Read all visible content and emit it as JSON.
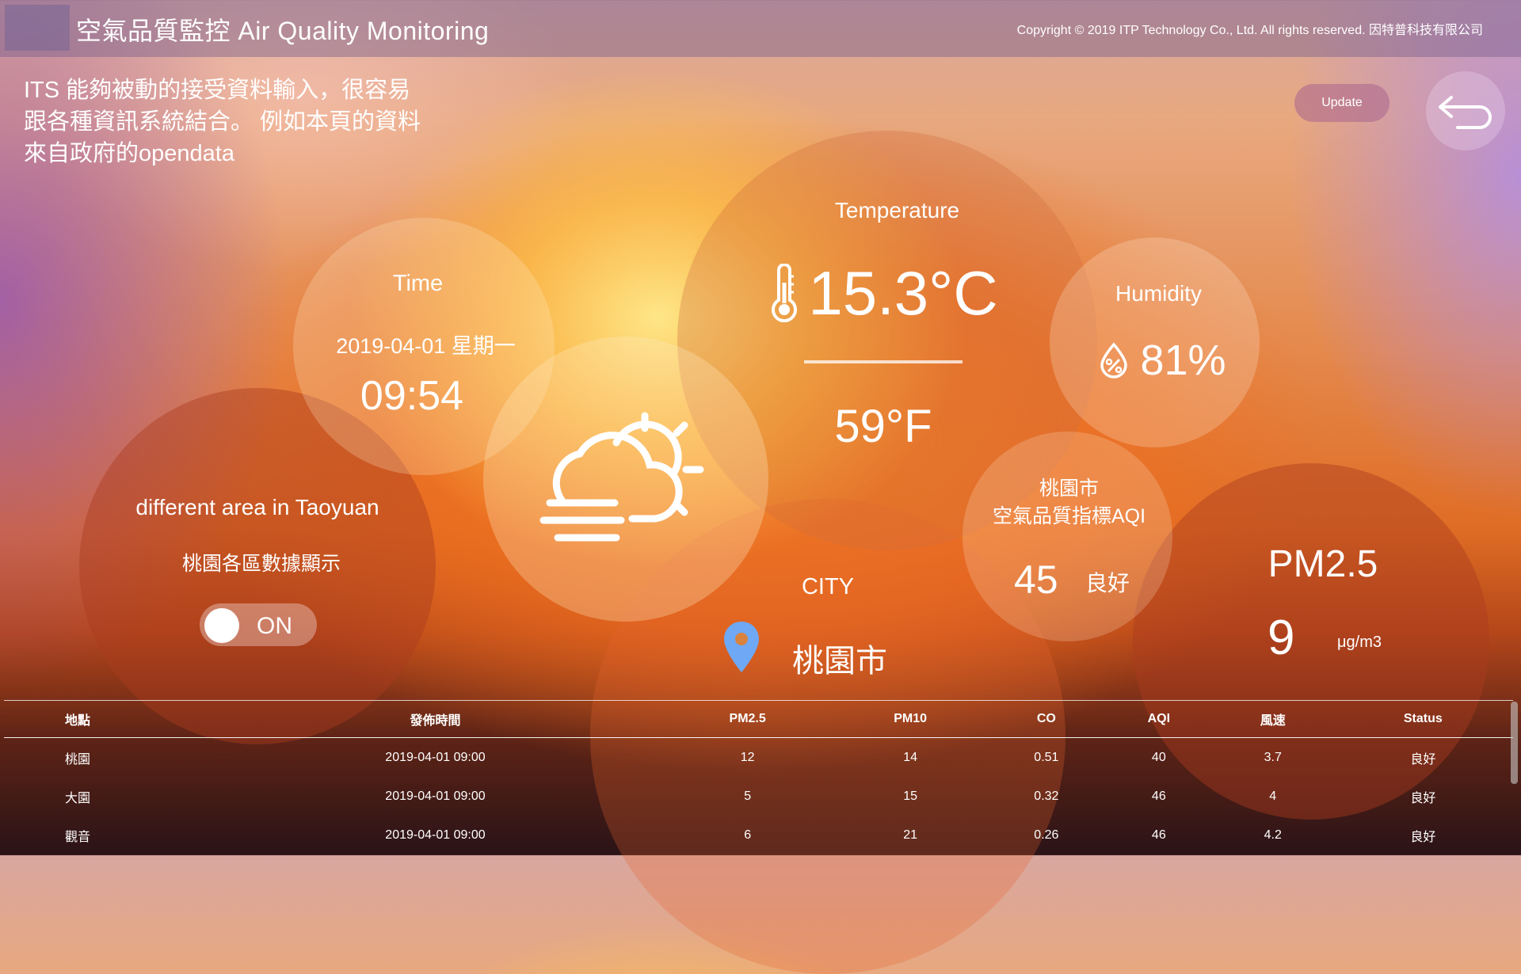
{
  "header": {
    "title": "空氣品質監控  Air Quality Monitoring",
    "copyright": "Copyright © 2019 ITP Technology Co., Ltd. All rights reserved. 因特普科技有限公司"
  },
  "intro": {
    "line1": "ITS 能夠被動的接受資料輸入，很容易",
    "line2": "跟各種資訊系統結合。 例如本頁的資料",
    "line3": "來自政府的opendata"
  },
  "controls": {
    "update_label": "Update"
  },
  "time": {
    "title": "Time",
    "date": "2019-04-01  星期一",
    "clock": "09:54"
  },
  "temperature": {
    "title": "Temperature",
    "celsius": "15.3°C",
    "fahrenheit": "59°F"
  },
  "humidity": {
    "title": "Humidity",
    "value": "81%"
  },
  "aqi": {
    "city_line1": "桃園市",
    "city_line2": "空氣品質指標AQI",
    "value": "45",
    "status": "良好"
  },
  "area": {
    "title": "different area in Taoyuan",
    "subtitle": "桃園各區數據顯示",
    "toggle_label": "ON",
    "toggle_on": true
  },
  "city": {
    "title": "CITY",
    "name": "桃園市"
  },
  "pm25": {
    "title": "PM2.5",
    "value": "9",
    "unit": "μg/m3"
  },
  "colors": {
    "pin": "#6fa8f5",
    "accent": "#e5762b"
  },
  "icons": {
    "weather": "partly-cloudy-foggy-icon",
    "thermometer": "thermometer-icon",
    "humidity": "humidity-drop-percent-icon",
    "location": "location-pin-icon",
    "back": "back-arrow-icon"
  },
  "table": {
    "headers": [
      "地點",
      "發佈時間",
      "PM2.5",
      "PM10",
      "CO",
      "AQI",
      "風速",
      "Status"
    ],
    "rows": [
      [
        "桃園",
        "2019-04-01 09:00",
        "12",
        "14",
        "0.51",
        "40",
        "3.7",
        "良好"
      ],
      [
        "大園",
        "2019-04-01 09:00",
        "5",
        "15",
        "0.32",
        "46",
        "4",
        "良好"
      ],
      [
        "觀音",
        "2019-04-01 09:00",
        "6",
        "21",
        "0.26",
        "46",
        "4.2",
        "良好"
      ]
    ]
  }
}
